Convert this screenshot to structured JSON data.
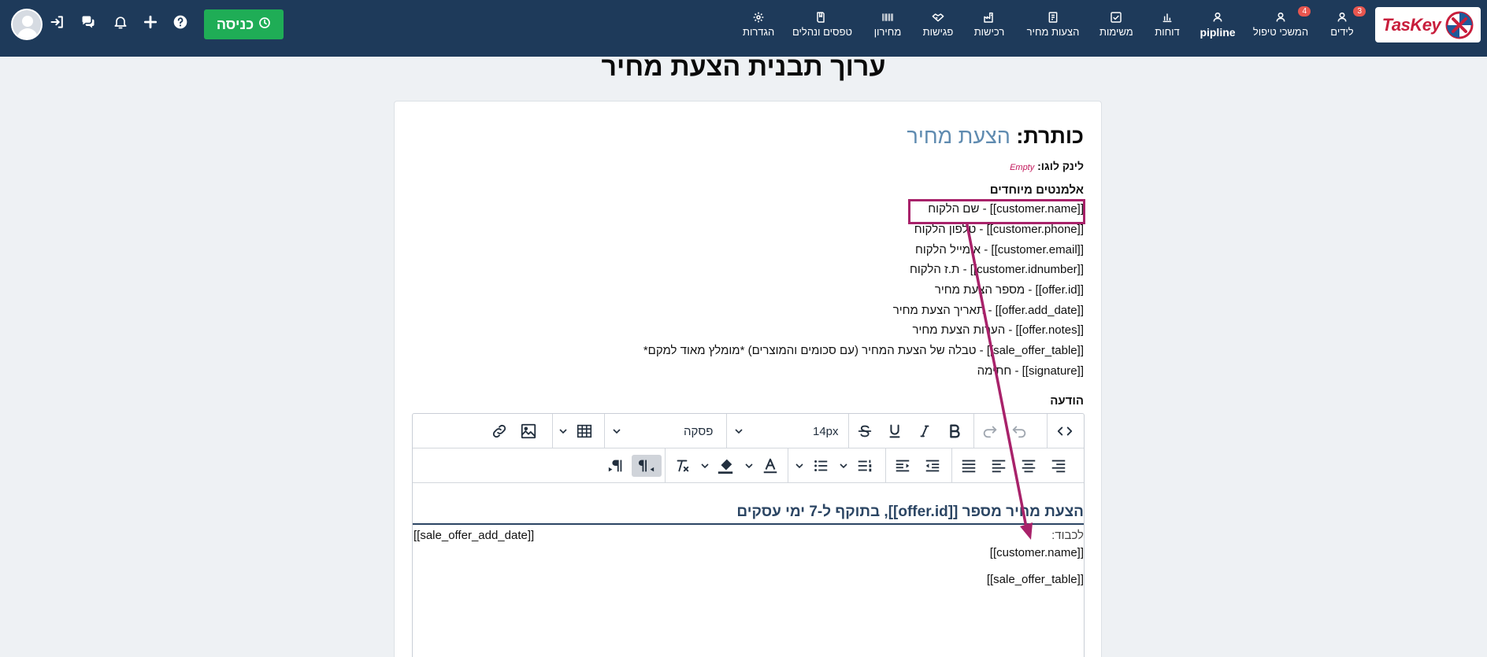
{
  "brand": {
    "name": "TasKey"
  },
  "nav": {
    "items": [
      {
        "label": "לידים",
        "icon": "user-icon",
        "badge": "3"
      },
      {
        "label": "המשכי טיפול",
        "icon": "user-icon",
        "badge": "4"
      },
      {
        "label": "pipline",
        "icon": "user-icon",
        "badge": ""
      },
      {
        "label": "דוחות",
        "icon": "bar-chart-icon",
        "badge": ""
      },
      {
        "label": "משימות",
        "icon": "checkbox-icon",
        "badge": ""
      },
      {
        "label": "הצעות מחיר",
        "icon": "price-offer-icon",
        "badge": ""
      },
      {
        "label": "רכישות",
        "icon": "factory-icon",
        "badge": ""
      },
      {
        "label": "פגישות",
        "icon": "handshake-icon",
        "badge": ""
      },
      {
        "label": "מחירון",
        "icon": "barcode-icon",
        "badge": ""
      },
      {
        "label": "טפסים ונהלים",
        "icon": "book-icon",
        "badge": ""
      },
      {
        "label": "הגדרות",
        "icon": "gear-icon",
        "badge": ""
      }
    ],
    "enter_button": "כניסה"
  },
  "page": {
    "title": "ערוך תבנית הצעת מחיר"
  },
  "template": {
    "title_label": "כותרת:",
    "title_value": "הצעת מחיר",
    "logo_label": "לינק לוגו:",
    "logo_value": "Empty",
    "special_heading": "אלמנטים מיוחדים",
    "special_items": [
      "[[customer.name]] - שם הלקוח",
      "[[customer.phone]] - טלפון הלקוח",
      "[[customer.email]] - אימייל הלקוח",
      "[[customer.idnumber]] - ת.ז הלקוח",
      "[[offer.id]] - מספר הצעת מחיר",
      "[[offer.add_date]] - תאריך הצעת מחיר",
      "[[offer.notes]] - הערות הצעת מחיר",
      "[[sale_offer_table]] - טבלה של הצעת המחיר (עם סכומים והמוצרים) *מומלץ מאוד למקם*",
      "[[signature]] - חתימה"
    ],
    "message_label": "הודעה"
  },
  "editor": {
    "font_size": "14px",
    "block_format": "פסקה",
    "content": {
      "heading": "הצעת מחיר מספר [[offer.id]], בתוקף ל-7 ימי עסקים",
      "to_label": "לכבוד:",
      "date_token": "[[sale_offer_add_date]]",
      "name_token": "[[customer.name]]",
      "table_token": "[[sale_offer_table]]"
    }
  },
  "colors": {
    "topbar": "#1e3a5a",
    "enter_button": "#1fad56",
    "badge": "#e8564f",
    "title_value": "#5f8bb0",
    "annotation": "#a8226a",
    "editor_heading": "#2b4563"
  }
}
